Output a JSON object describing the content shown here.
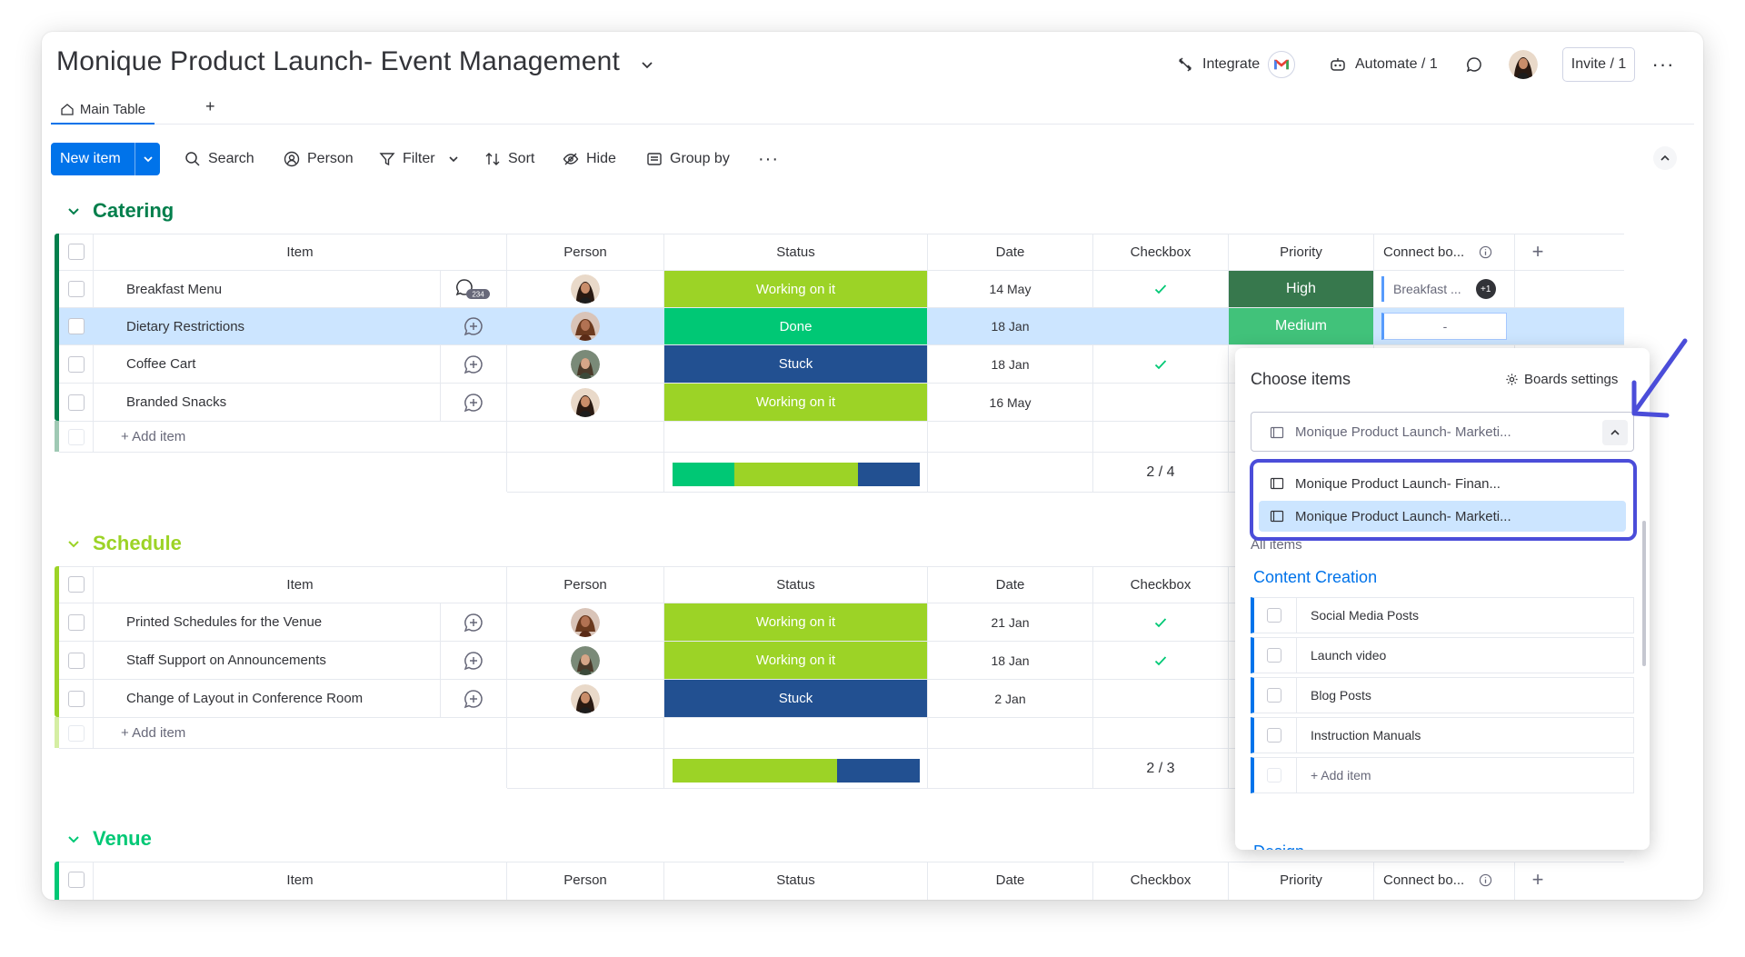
{
  "header": {
    "board_title": "Monique Product Launch- Event Management",
    "integrate_label": "Integrate",
    "automate_label": "Automate / 1",
    "invite_label": "Invite / 1"
  },
  "tabs": {
    "main_table": "Main Table",
    "add": "+"
  },
  "toolbar": {
    "new_item": "New item",
    "search": "Search",
    "person": "Person",
    "filter": "Filter",
    "sort": "Sort",
    "hide": "Hide",
    "group_by": "Group by"
  },
  "columns": {
    "item": "Item",
    "person": "Person",
    "status": "Status",
    "date": "Date",
    "checkbox": "Checkbox",
    "priority": "Priority",
    "connect": "Connect bo..."
  },
  "colors": {
    "working": "#9cd326",
    "done": "#00c875",
    "stuck": "#225091",
    "high": "#401694",
    "medium": "#5559df",
    "catering": "#037f4c",
    "schedule": "#9cd326",
    "venue": "#00c875"
  },
  "groups": {
    "catering": {
      "title": "Catering",
      "rows": [
        {
          "item": "Breakfast Menu",
          "status": "Working on it",
          "date": "14 May",
          "priority": "High",
          "connect": "Breakfast ...",
          "connect_extra": "+1",
          "updates": "234"
        },
        {
          "item": "Dietary Restrictions",
          "status": "Done",
          "date": "18 Jan",
          "priority": "Medium",
          "connect": "-"
        },
        {
          "item": "Coffee Cart",
          "status": "Stuck",
          "date": "18 Jan"
        },
        {
          "item": "Branded Snacks",
          "status": "Working on it",
          "date": "16 May"
        }
      ],
      "add_item": "+ Add item",
      "checkbox_summary": "2 / 4"
    },
    "schedule": {
      "title": "Schedule",
      "rows": [
        {
          "item": "Printed Schedules for the Venue",
          "status": "Working on it",
          "date": "21 Jan"
        },
        {
          "item": "Staff Support on Announcements",
          "status": "Working on it",
          "date": "18 Jan"
        },
        {
          "item": "Change of Layout in Conference Room",
          "status": "Stuck",
          "date": "2 Jan"
        }
      ],
      "add_item": "+ Add item",
      "checkbox_summary": "2 / 3"
    },
    "venue": {
      "title": "Venue"
    }
  },
  "dropdown": {
    "title": "Choose items",
    "boards_settings": "Boards settings",
    "selected_board": "Monique Product Launch- Marketi...",
    "options": [
      "Monique Product Launch- Finan...",
      "Monique Product Launch- Marketi..."
    ],
    "all_items": "All items",
    "section_title": "Content Creation",
    "items": [
      "Social Media Posts",
      "Launch video",
      "Blog Posts",
      "Instruction Manuals"
    ],
    "add_item": "+ Add item",
    "next_section": "Design"
  }
}
